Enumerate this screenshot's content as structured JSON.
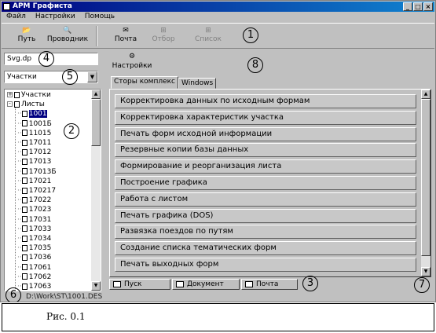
{
  "window": {
    "title": "АРМ Графиста",
    "controls": [
      "_",
      "□",
      "×"
    ]
  },
  "menu": [
    "Файл",
    "Настройки",
    "Помощь"
  ],
  "toolbar": [
    {
      "label": "Путь",
      "icon": "folder-open-icon",
      "enabled": true
    },
    {
      "label": "Проводник",
      "icon": "explorer-icon",
      "enabled": true
    },
    {
      "label": "Почта",
      "icon": "mail-icon",
      "enabled": true
    },
    {
      "label": "Отбор",
      "icon": "filter-icon",
      "enabled": false
    },
    {
      "label": "Список",
      "icon": "list-icon",
      "enabled": false
    }
  ],
  "left": {
    "path_field_value": "Svg.dp",
    "select_value": "Участки"
  },
  "tree": {
    "nodes": [
      {
        "label": "Участки",
        "expander": "+",
        "level": 0
      },
      {
        "label": "Листы",
        "expander": "-",
        "level": 0
      },
      {
        "label": "1001",
        "level": 1,
        "selected": true
      },
      {
        "label": "1001Б",
        "level": 1
      },
      {
        "label": "11015",
        "level": 1
      },
      {
        "label": "17011",
        "level": 1
      },
      {
        "label": "17012",
        "level": 1
      },
      {
        "label": "17013",
        "level": 1
      },
      {
        "label": "17013Б",
        "level": 1
      },
      {
        "label": "17021",
        "level": 1
      },
      {
        "label": "170217",
        "level": 1
      },
      {
        "label": "17022",
        "level": 1
      },
      {
        "label": "17023",
        "level": 1
      },
      {
        "label": "17031",
        "level": 1
      },
      {
        "label": "17033",
        "level": 1
      },
      {
        "label": "17034",
        "level": 1
      },
      {
        "label": "17035",
        "level": 1
      },
      {
        "label": "17036",
        "level": 1
      },
      {
        "label": "17061",
        "level": 1
      },
      {
        "label": "17062",
        "level": 1
      },
      {
        "label": "17063",
        "level": 1
      }
    ]
  },
  "settings_button": "Настройки",
  "tabs": [
    {
      "label": "Сторы комплекс",
      "active": true
    },
    {
      "label": "Windows",
      "active": false
    }
  ],
  "commands": [
    "Корректировка данных по исходным формам",
    "Корректировка характеристик участка",
    "Печать форм исходной информации",
    "Резервные копии базы данных",
    "Формирование и реорганизация листа",
    "Построение графика",
    "Работа с листом",
    "Печать графика (DOS)",
    "Развязка поездов по путям",
    "Создание списка тематических форм",
    "Печать выходных форм"
  ],
  "bottom_tabs": [
    {
      "label": "Пуск",
      "icon": "window-icon"
    },
    {
      "label": "Документ",
      "icon": "document-icon"
    },
    {
      "label": "Почта",
      "icon": "mail-icon"
    }
  ],
  "status": "D:\\Work\\ST\\1001.DES",
  "callouts": [
    "1",
    "2",
    "3",
    "4",
    "5",
    "6",
    "7",
    "8"
  ],
  "caption": "Рис. 0.1"
}
